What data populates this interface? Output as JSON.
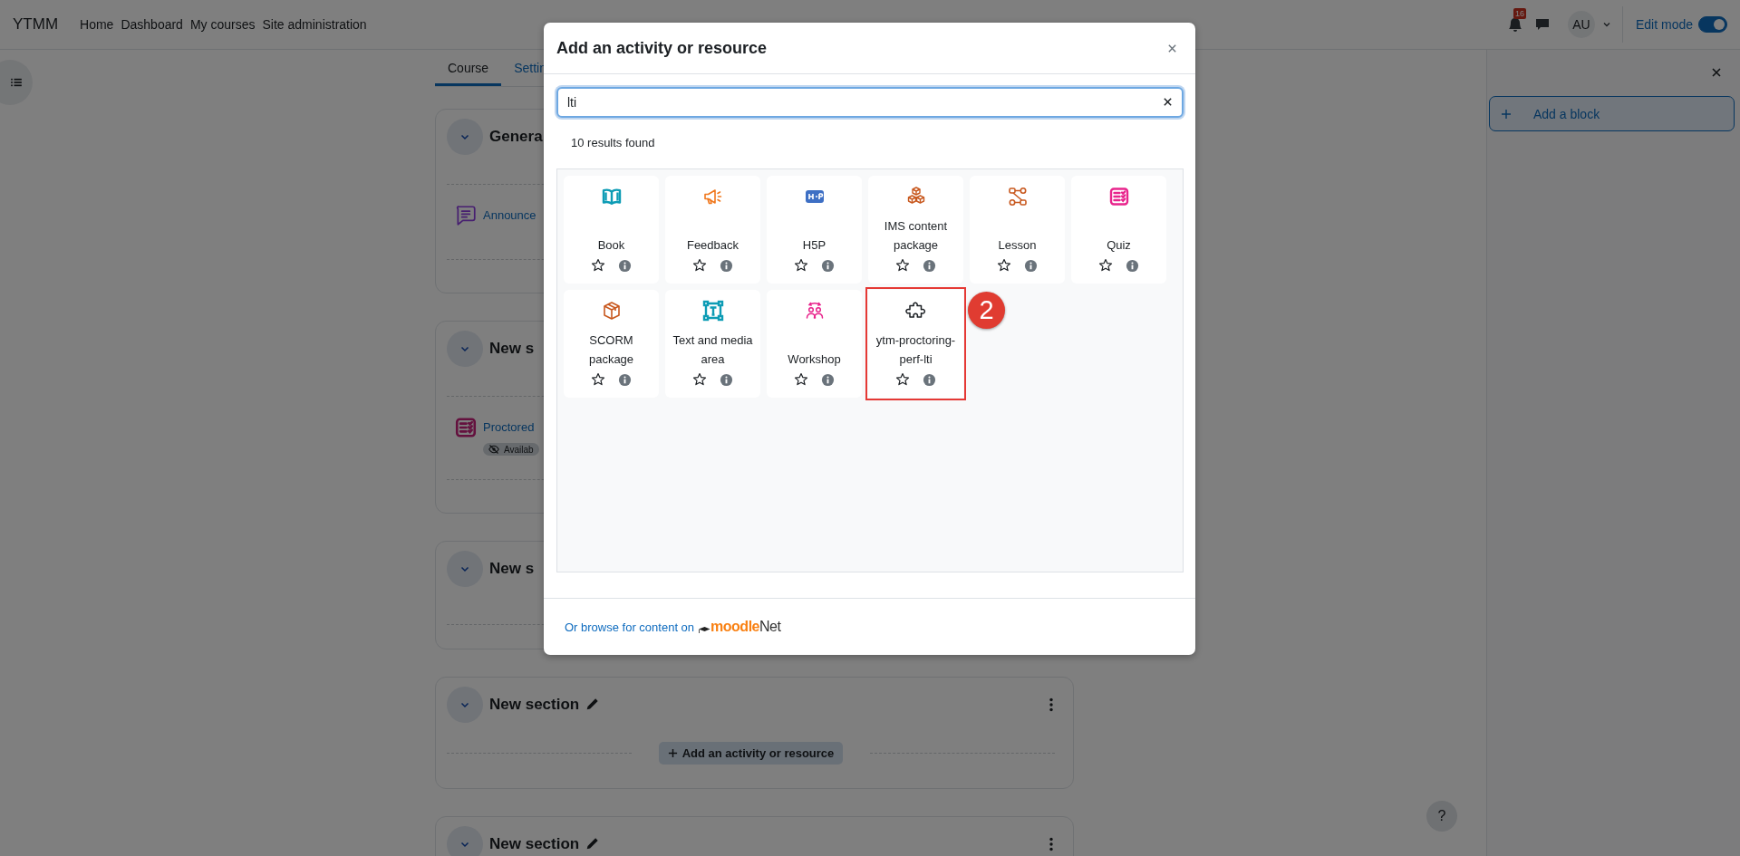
{
  "navbar": {
    "brand": "YTMM",
    "links": [
      {
        "label": "Home"
      },
      {
        "label": "Dashboard"
      },
      {
        "label": "My courses"
      },
      {
        "label": "Site administration"
      }
    ],
    "notification_count": "16",
    "avatar_initials": "AU",
    "edit_mode": {
      "label": "Edit mode",
      "on": true
    }
  },
  "course_tabs": [
    {
      "label": "Course",
      "selected": true
    },
    {
      "label": "Settin",
      "selected": false
    }
  ],
  "sections": [
    {
      "title": "Genera",
      "editable": false,
      "menu": false,
      "activities": [
        {
          "kind": "forum",
          "name": "Announce"
        }
      ]
    },
    {
      "title": "New s",
      "editable": false,
      "menu": false,
      "activities": [
        {
          "kind": "quiz",
          "name": "Proctored",
          "badge": "Availab"
        }
      ]
    },
    {
      "title": "New s",
      "editable": false,
      "menu": false
    },
    {
      "title": "New section",
      "editable": true,
      "menu": true,
      "add_activity": "Add an activity or resource"
    },
    {
      "title": "New section",
      "editable": true,
      "menu": true
    }
  ],
  "block_drawer": {
    "add_block": "Add a block"
  },
  "help_button": "?",
  "modal": {
    "title": "Add an activity or resource",
    "search": {
      "value": "lti"
    },
    "results_text": "10 results found",
    "items": [
      {
        "name": "Book",
        "kind": "book",
        "color": "#0d9cb5",
        "starred": false,
        "highlighted": false
      },
      {
        "name": "Feedback",
        "kind": "megaphone",
        "color": "#f0781e",
        "starred": false,
        "highlighted": false
      },
      {
        "name": "H5P",
        "kind": "h5p",
        "color": "#3d6fc4",
        "starred": false,
        "highlighted": false
      },
      {
        "name": "IMS content package",
        "kind": "boxes",
        "color": "#c8581e",
        "starred": false,
        "highlighted": false
      },
      {
        "name": "Lesson",
        "kind": "nodes",
        "color": "#c8581e",
        "starred": false,
        "highlighted": false
      },
      {
        "name": "Quiz",
        "kind": "quiz",
        "color": "#e8248c",
        "starred": false,
        "highlighted": false
      },
      {
        "name": "SCORM package",
        "kind": "cube",
        "color": "#c8581e",
        "starred": false,
        "highlighted": false
      },
      {
        "name": "Text and media area",
        "kind": "frame",
        "color": "#0d9cb5",
        "starred": false,
        "highlighted": false
      },
      {
        "name": "Workshop",
        "kind": "people",
        "color": "#e8248c",
        "starred": false,
        "highlighted": false
      },
      {
        "name": "ytm-proctoring-perf-lti",
        "kind": "puzzle",
        "color": "#1d2125",
        "starred": false,
        "highlighted": true,
        "callout": "2"
      }
    ],
    "footer": {
      "link_text": "Or browse for content on",
      "logo_brand": "moodle",
      "logo_suffix": "Net"
    }
  }
}
